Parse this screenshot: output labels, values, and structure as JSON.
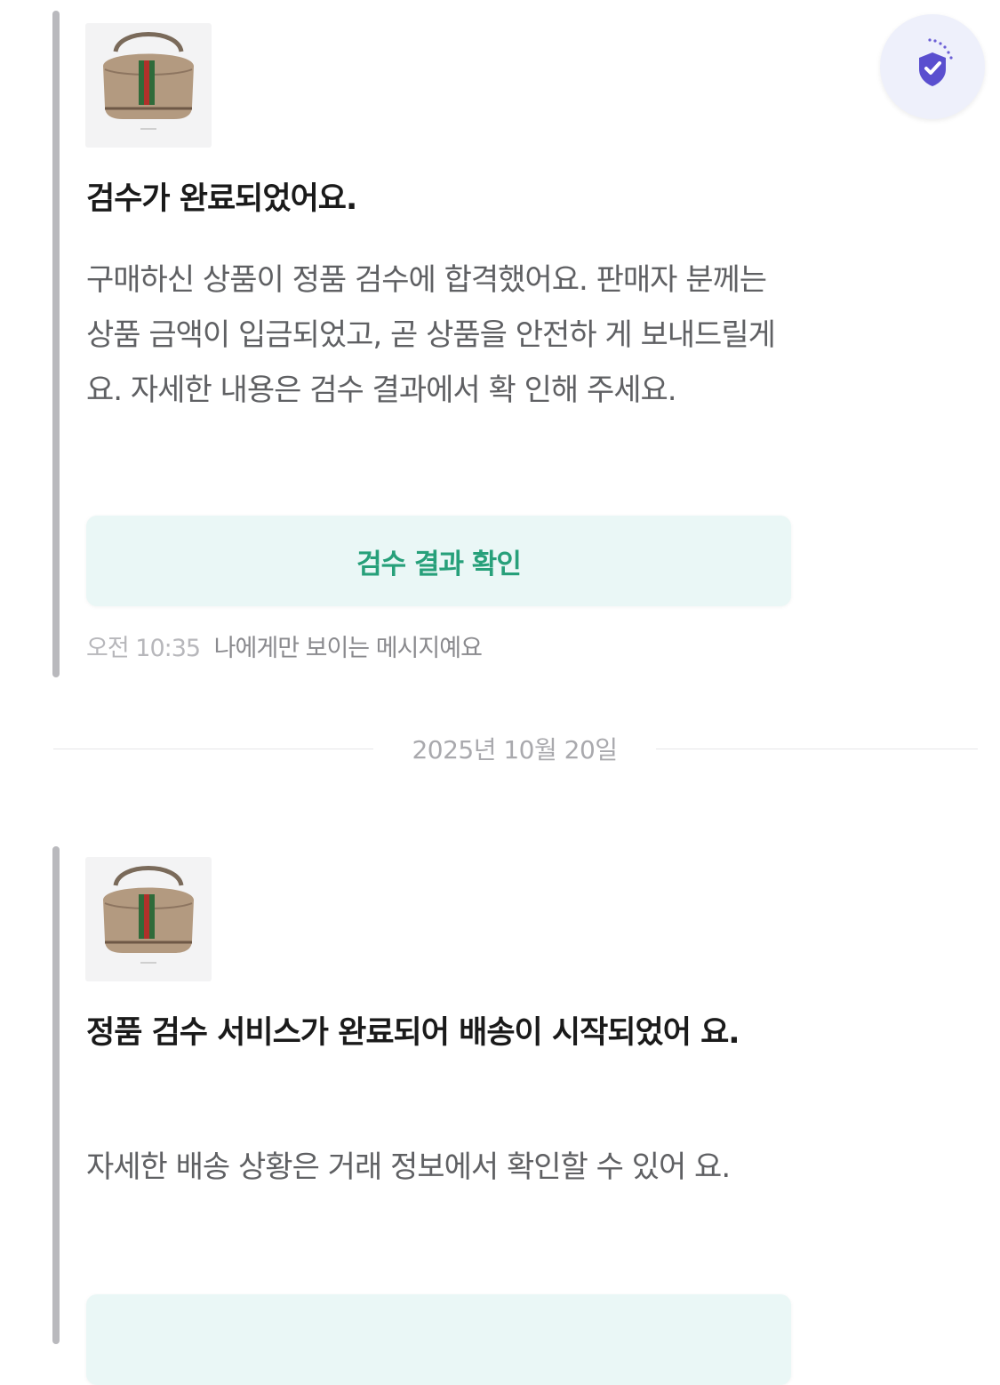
{
  "messages": [
    {
      "title": "검수가 완료되었어요.",
      "body": "구매하신 상품이 정품 검수에 합격했어요. 판매자 분께는 상품 금액이 입금되었고, 곧 상품을 안전하 게 보내드릴게요. 자세한 내용은 검수 결과에서 확 인해 주세요.",
      "button_label": "검수 결과 확인",
      "time": "오전 10:35",
      "visibility_note": "나에게만 보이는 메시지예요"
    },
    {
      "title": "정품 검수 서비스가 완료되어 배송이 시작되었어 요.",
      "body": "자세한 배송 상황은 거래 정보에서 확인할 수 있어 요."
    }
  ],
  "date_separator": "2025년 10월 20일",
  "icons": {
    "product": "handbag-thumbnail",
    "fab": "shield-check-icon"
  },
  "colors": {
    "accent_green": "#27a07a",
    "button_bg": "#eaf7f6",
    "shield_purple": "#5a4fcf"
  }
}
